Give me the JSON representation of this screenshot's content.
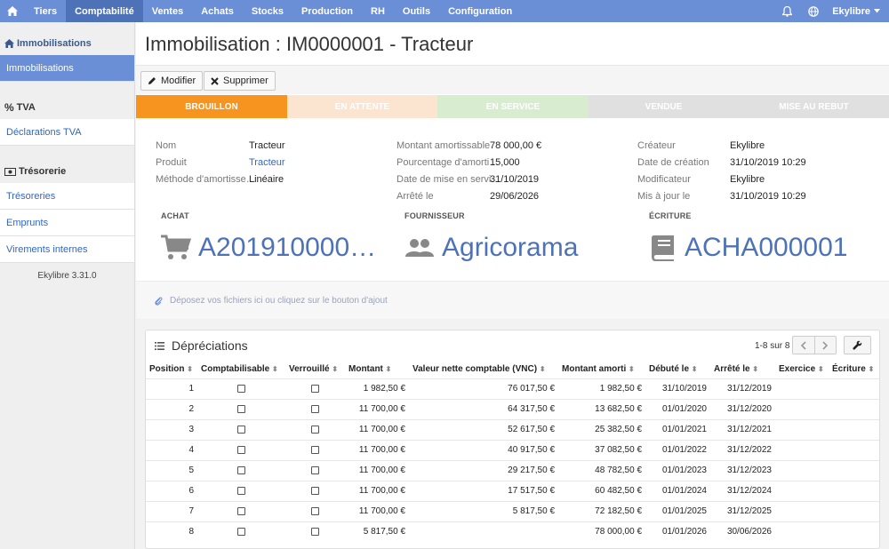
{
  "nav": {
    "items": [
      "Tiers",
      "Comptabilité",
      "Ventes",
      "Achats",
      "Stocks",
      "Production",
      "RH",
      "Outils",
      "Configuration"
    ],
    "active": "Comptabilité",
    "user": "Ekylibre"
  },
  "sidebar": {
    "sections": [
      {
        "title": "Immobilisations",
        "items": [
          "Immobilisations"
        ]
      },
      {
        "title": "TVA",
        "items": [
          "Déclarations TVA"
        ]
      },
      {
        "title": "Trésorerie",
        "items": [
          "Trésoreries",
          "Emprunts",
          "Virements internes"
        ]
      }
    ],
    "version": "Ekylibre 3.31.0"
  },
  "page": {
    "title": "Immobilisation : IM0000001 - Tracteur",
    "buttons": {
      "edit": "Modifier",
      "delete": "Supprimer"
    }
  },
  "status_steps": [
    {
      "label": "BROUILLON",
      "color": "#f79420",
      "text": "#ffffff"
    },
    {
      "label": "EN ATTENTE",
      "color": "#fbe4d0",
      "text": "#ffffff"
    },
    {
      "label": "EN SERVICE",
      "color": "#d8ecd0",
      "text": "#ffffff"
    },
    {
      "label": "VENDUE",
      "color": "#e0e0e0",
      "text": "#ffffff"
    },
    {
      "label": "MISE AU REBUT",
      "color": "#e0e0e0",
      "text": "#ffffff"
    }
  ],
  "details": {
    "col1": [
      {
        "label": "Nom",
        "value": "Tracteur"
      },
      {
        "label": "Produit",
        "value": "Tracteur"
      },
      {
        "label": "Méthode d'amortisse…",
        "value": "Linéaire"
      }
    ],
    "col2": [
      {
        "label": "Montant amortissable",
        "value": "78 000,00 €"
      },
      {
        "label": "Pourcentage d'amorti…",
        "value": "15,000"
      },
      {
        "label": "Date de mise en servi…",
        "value": "31/10/2019"
      },
      {
        "label": "Arrêté le",
        "value": "29/06/2026"
      }
    ],
    "col3": [
      {
        "label": "Créateur",
        "value": "Ekylibre"
      },
      {
        "label": "Date de création",
        "value": "31/10/2019 10:29"
      },
      {
        "label": "Modificateur",
        "value": "Ekylibre"
      },
      {
        "label": "Mis à jour le",
        "value": "31/10/2019 10:29"
      }
    ]
  },
  "cards": {
    "achat": {
      "title": "ACHAT",
      "value": "A201910000…"
    },
    "fournisseur": {
      "title": "FOURNISSEUR",
      "value": "Agricorama"
    },
    "ecriture": {
      "title": "ÉCRITURE",
      "value": "ACHA000001"
    }
  },
  "dropzone": "Déposez vos fichiers ici ou cliquez sur le bouton d'ajout",
  "depreciations": {
    "title": "Dépréciations",
    "pager": "1-8 sur 8",
    "columns": [
      "Position",
      "Comptabilisable",
      "Verrouillé",
      "Montant",
      "Valeur nette comptable (VNC)",
      "Montant amorti",
      "Débuté le",
      "Arrêté le",
      "Exercice",
      "Écriture"
    ],
    "rows": [
      {
        "position": "1",
        "montant": "1 982,50 €",
        "vnc": "76 017,50 €",
        "amorti": "1 982,50 €",
        "debut": "31/10/2019",
        "arrete": "31/12/2019"
      },
      {
        "position": "2",
        "montant": "11 700,00 €",
        "vnc": "64 317,50 €",
        "amorti": "13 682,50 €",
        "debut": "01/01/2020",
        "arrete": "31/12/2020"
      },
      {
        "position": "3",
        "montant": "11 700,00 €",
        "vnc": "52 617,50 €",
        "amorti": "25 382,50 €",
        "debut": "01/01/2021",
        "arrete": "31/12/2021"
      },
      {
        "position": "4",
        "montant": "11 700,00 €",
        "vnc": "40 917,50 €",
        "amorti": "37 082,50 €",
        "debut": "01/01/2022",
        "arrete": "31/12/2022"
      },
      {
        "position": "5",
        "montant": "11 700,00 €",
        "vnc": "29 217,50 €",
        "amorti": "48 782,50 €",
        "debut": "01/01/2023",
        "arrete": "31/12/2023"
      },
      {
        "position": "6",
        "montant": "11 700,00 €",
        "vnc": "17 517,50 €",
        "amorti": "60 482,50 €",
        "debut": "01/01/2024",
        "arrete": "31/12/2024"
      },
      {
        "position": "7",
        "montant": "11 700,00 €",
        "vnc": "5 817,50 €",
        "amorti": "72 182,50 €",
        "debut": "01/01/2025",
        "arrete": "31/12/2025"
      },
      {
        "position": "8",
        "montant": "5 817,50 €",
        "vnc": "",
        "amorti": "78 000,00 €",
        "debut": "01/01/2026",
        "arrete": "30/06/2026"
      }
    ]
  },
  "colors": {
    "accent": "#6b8fd6",
    "accent_dark": "#4e72b8",
    "link": "#3366bb"
  }
}
